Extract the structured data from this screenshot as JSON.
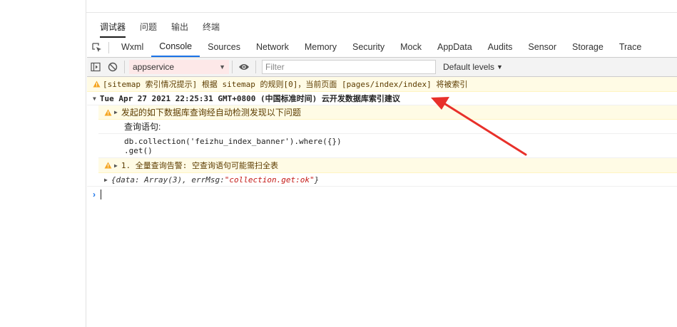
{
  "top_tabs": [
    "调试器",
    "问题",
    "输出",
    "终端"
  ],
  "devtools_tabs": [
    "Wxml",
    "Console",
    "Sources",
    "Network",
    "Memory",
    "Security",
    "Mock",
    "AppData",
    "Audits",
    "Sensor",
    "Storage",
    "Trace"
  ],
  "toolbar": {
    "context": "appservice",
    "filter_placeholder": "Filter",
    "levels": "Default levels"
  },
  "console": {
    "sitemap_warning": "[sitemap 索引情况提示] 根据 sitemap 的规则[0]，当前页面 [pages/index/index] 将被索引",
    "group_title": "Tue Apr 27 2021 22:25:31 GMT+0800 (中国标准时间) 云开发数据库索引建议",
    "warn_issue": "发起的如下数据库查询经自动检测发现以下问题",
    "query_label": "查询语句:",
    "code_line1": "db.collection('feizhu_index_banner').where({})",
    "code_line2": ".get()",
    "warn_fullscan": "1. 全量查询告警: 空查询语句可能需扫全表",
    "obj_prefix": "{data: Array(3), errMsg: ",
    "obj_string": "\"collection.get:ok\"",
    "obj_suffix": "}"
  },
  "colors": {
    "warning_bg": "#fffbe5",
    "warning_icon": "#f5a623",
    "active_tab_underline": "#1a73e8",
    "annotation_arrow": "#e8302a"
  }
}
